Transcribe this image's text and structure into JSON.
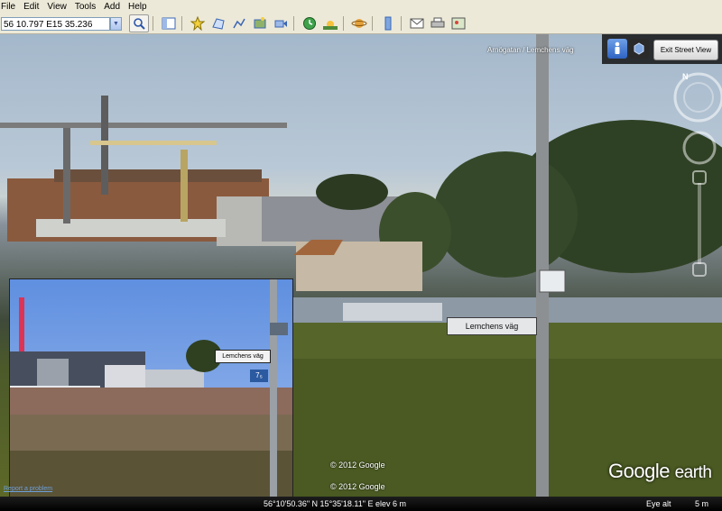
{
  "menu": [
    "File",
    "Edit",
    "View",
    "Tools",
    "Add",
    "Help"
  ],
  "search": {
    "value": "56 10.797 E15 35.236"
  },
  "street_name": "Arnögatan / Lemchens väg",
  "nav": {
    "exit_label": "Exit Street View"
  },
  "inset": {
    "sign_label": "Lemchens väg",
    "sign_number": "7₅"
  },
  "scene": {
    "sign_label": "Lemchens väg"
  },
  "copyrights": [
    "© 2012 Google",
    "© 2012 Google"
  ],
  "report_link": "Report a problem",
  "logo": {
    "google": "Google",
    "earth": "earth"
  },
  "status": {
    "coords": "56°10'50.36\" N   15°35'18.11\" E  elev     6 m",
    "eye_alt_label": "Eye alt",
    "eye_alt_value": "5 m"
  },
  "colors": {
    "menubar": "#ece9d8",
    "statusbar": "#000000",
    "link": "#6e9fd8"
  }
}
